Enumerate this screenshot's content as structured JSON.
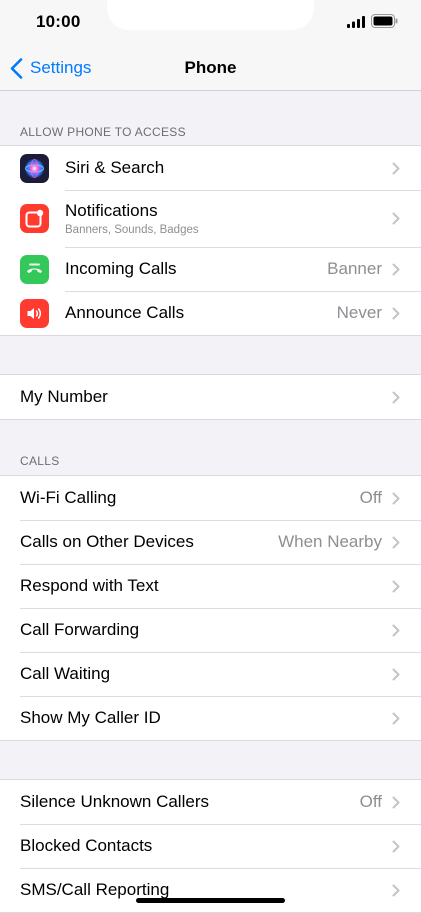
{
  "status": {
    "time": "10:00"
  },
  "nav": {
    "back_label": "Settings",
    "title": "Phone"
  },
  "sections": {
    "allow_access": {
      "header": "ALLOW PHONE TO ACCESS",
      "items": [
        {
          "label": "Siri & Search",
          "icon": "siri-icon",
          "value": ""
        },
        {
          "label": "Notifications",
          "icon": "notifications-icon",
          "sub": "Banners, Sounds, Badges",
          "value": ""
        },
        {
          "label": "Incoming Calls",
          "icon": "incoming-calls-icon",
          "value": "Banner"
        },
        {
          "label": "Announce Calls",
          "icon": "announce-calls-icon",
          "value": "Never"
        }
      ]
    },
    "number": {
      "items": [
        {
          "label": "My Number",
          "value": ""
        }
      ]
    },
    "calls": {
      "header": "CALLS",
      "items": [
        {
          "label": "Wi-Fi Calling",
          "value": "Off"
        },
        {
          "label": "Calls on Other Devices",
          "value": "When Nearby"
        },
        {
          "label": "Respond with Text",
          "value": ""
        },
        {
          "label": "Call Forwarding",
          "value": ""
        },
        {
          "label": "Call Waiting",
          "value": ""
        },
        {
          "label": "Show My Caller ID",
          "value": ""
        }
      ]
    },
    "blocking": {
      "items": [
        {
          "label": "Silence Unknown Callers",
          "value": "Off"
        },
        {
          "label": "Blocked Contacts",
          "value": ""
        },
        {
          "label": "SMS/Call Reporting",
          "value": ""
        }
      ]
    }
  },
  "colors": {
    "accent": "#007aff",
    "notifications": "#ff3b30",
    "incoming_calls": "#34c759",
    "announce_calls": "#ff3b30",
    "siri_bg": "#1c1c3a"
  }
}
